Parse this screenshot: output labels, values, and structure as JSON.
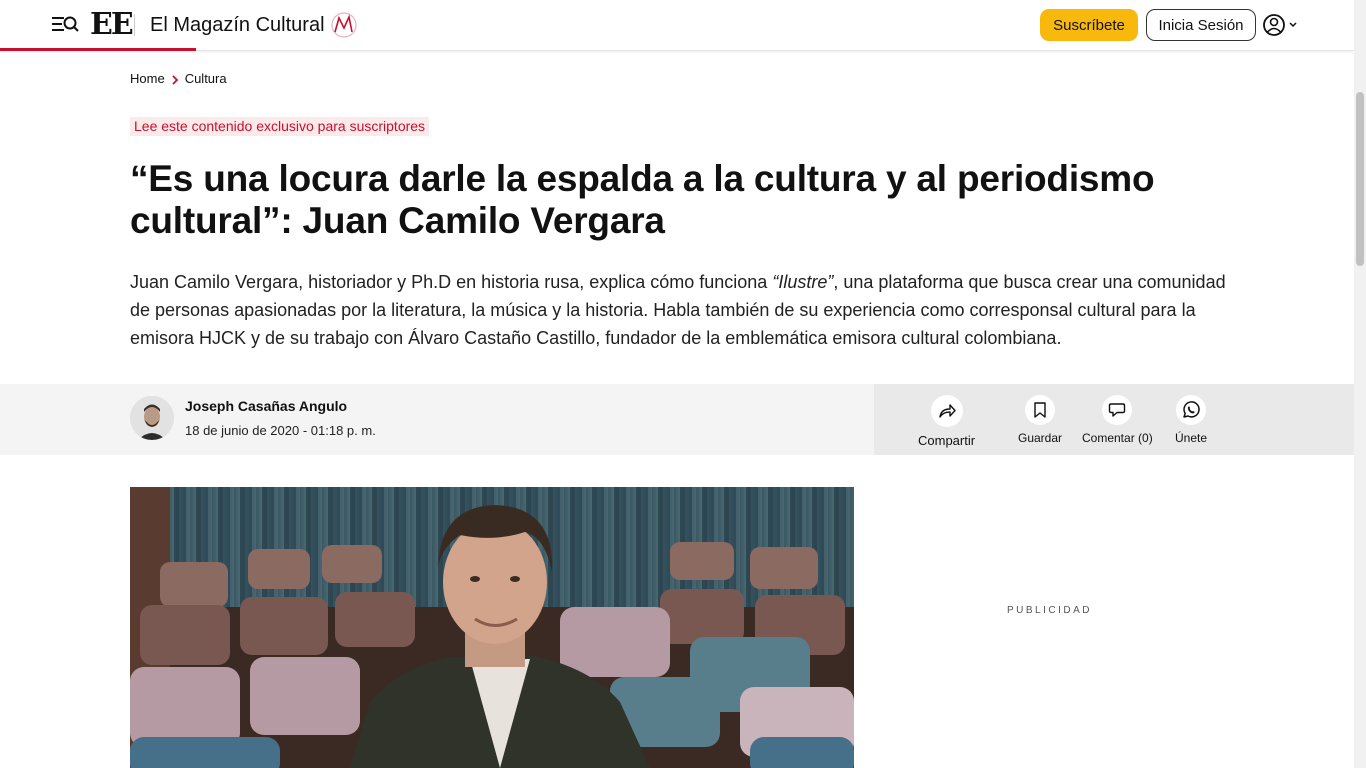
{
  "header": {
    "logo_text": "EE",
    "section_title": "El Magazín Cultural",
    "subscribe_label": "Suscríbete",
    "login_label": "Inicia Sesión",
    "icons": [
      "menu-search-icon",
      "magazin-logo-icon",
      "user-icon",
      "chevron-down-icon"
    ],
    "accent_color": "#c8102e",
    "subscribe_color": "#f8b90c"
  },
  "breadcrumb": {
    "home": "Home",
    "section": "Cultura"
  },
  "article": {
    "exclusive_label": "Lee este contenido exclusivo para suscriptores",
    "headline": "“Es una locura darle la espalda a la cultura y al periodismo cultural”: Juan Camilo Vergara",
    "lead_part1": "Juan Camilo Vergara, historiador y Ph.D en historia rusa, explica cómo funciona ",
    "lead_italic": "“Ilustre”",
    "lead_part2": ", una plataforma que busca crear una comunidad de personas apasionadas por la literatura, la música y la historia. Habla también de su experiencia como corresponsal cultural para la emisora HJCK y de su trabajo con Álvaro Castaño Castillo, fundador de la emblemática emisora cultural colombiana.",
    "author": "Joseph Casañas Angulo",
    "date": "18 de junio de 2020 - 01:18 p. m."
  },
  "actions": {
    "share": "Compartir",
    "save": "Guardar",
    "comment": "Comentar (0)",
    "join": "Únete"
  },
  "sidebar": {
    "ad_label": "PUBLICIDAD"
  }
}
